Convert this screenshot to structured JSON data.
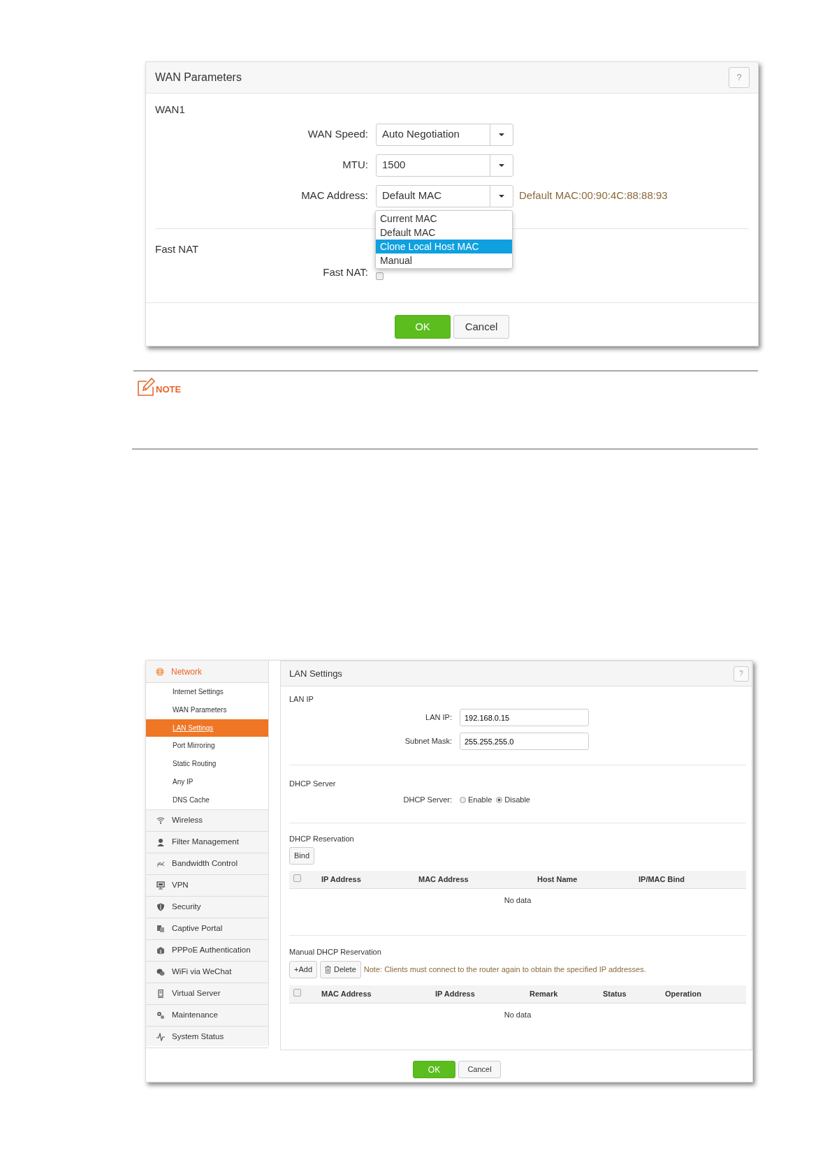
{
  "wan_panel": {
    "title": "WAN Parameters",
    "help": "?",
    "section": "WAN1",
    "fields": [
      {
        "label": "WAN Speed:",
        "value": "Auto Negotiation"
      },
      {
        "label": "MTU:",
        "value": "1500"
      },
      {
        "label": "MAC Address:",
        "value": "Default MAC",
        "hint": "Default MAC:00:90:4C:88:88:93"
      }
    ],
    "dropdown": {
      "expanded": true,
      "options": [
        {
          "label": "Current MAC",
          "selected": false
        },
        {
          "label": "Default MAC",
          "selected": false
        },
        {
          "label": "Clone Local Host MAC",
          "selected": true
        },
        {
          "label": "Manual",
          "selected": false
        }
      ]
    },
    "fast_nat": {
      "section": "Fast NAT",
      "label": "Fast NAT:",
      "checked": false
    },
    "buttons": [
      "OK",
      "Cancel"
    ]
  },
  "note": {
    "label": "NOTE"
  },
  "router_ui": {
    "sidebar": {
      "group": {
        "label": "Network",
        "children": [
          {
            "label": "Internet Settings",
            "selected": false
          },
          {
            "label": "WAN Parameters",
            "selected": false
          },
          {
            "label": "LAN Settings",
            "selected": true
          },
          {
            "label": "Port Mirroring",
            "selected": false
          },
          {
            "label": "Static Routing",
            "selected": false
          },
          {
            "label": "Any IP",
            "selected": false
          },
          {
            "label": "DNS Cache",
            "selected": false
          }
        ]
      },
      "items": [
        "Wireless",
        "Filter Management",
        "Bandwidth Control",
        "VPN",
        "Security",
        "Captive Portal",
        "PPPoE Authentication",
        "WiFi via WeChat",
        "Virtual Server",
        "Maintenance",
        "System Status"
      ]
    },
    "panel": {
      "title": "LAN Settings",
      "help": "?",
      "lan_ip": {
        "heading": "LAN IP",
        "fields": [
          {
            "label": "LAN IP:",
            "value": "192.168.0.15"
          },
          {
            "label": "Subnet Mask:",
            "value": "255.255.255.0"
          }
        ]
      },
      "dhcp_server": {
        "heading": "DHCP Server",
        "label": "DHCP Server:",
        "options": [
          {
            "label": "Enable",
            "selected": false
          },
          {
            "label": "Disable",
            "selected": true
          }
        ]
      },
      "dhcp_reservation": {
        "heading": "DHCP Reservation",
        "button": "Bind",
        "select_all": false,
        "columns": [
          "IP Address",
          "MAC Address",
          "Host Name",
          "IP/MAC Bind"
        ],
        "empty": "No data"
      },
      "manual_reservation": {
        "heading": "Manual DHCP Reservation",
        "buttons": [
          "+Add",
          "Delete"
        ],
        "note": "Note: Clients must connect to the router again to obtain the specified IP addresses.",
        "select_all": false,
        "columns": [
          "MAC Address",
          "IP Address",
          "Remark",
          "Status",
          "Operation"
        ],
        "empty": "No data"
      }
    },
    "buttons": [
      "OK",
      "Cancel"
    ]
  }
}
